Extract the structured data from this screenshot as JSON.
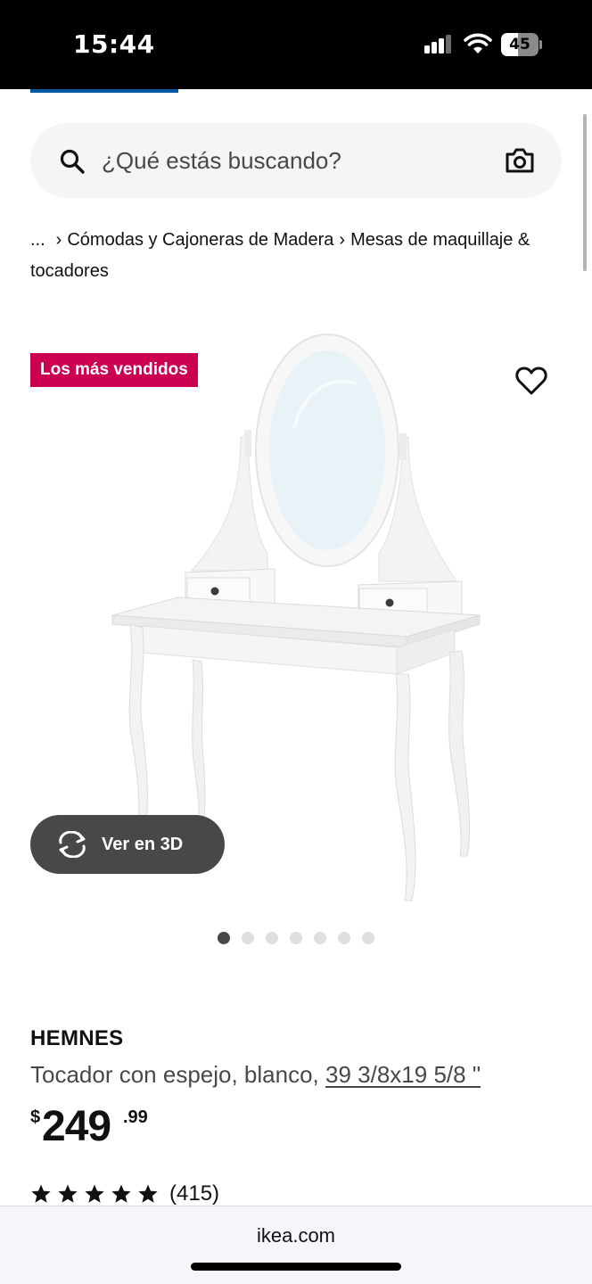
{
  "status_bar": {
    "time": "15:44",
    "battery": {
      "label": "45",
      "level": 0.45
    },
    "signal_icon": "cellular-signal-icon",
    "wifi_icon": "wifi-icon"
  },
  "search": {
    "placeholder": "¿Qué estás buscando?",
    "search_icon": "search-icon",
    "camera_icon": "camera-icon"
  },
  "breadcrumb": {
    "ellipsis": "...",
    "items": [
      "Cómodas y Cajoneras de Madera",
      "Mesas de maquillaje & tocadores"
    ]
  },
  "product": {
    "badge": "Los más vendidos",
    "view_3d_label": "Ver en 3D",
    "gallery": {
      "total": 7,
      "active_index": 0
    },
    "name": "HEMNES",
    "description": "Tocador con espejo, blanco,",
    "size": "39 3/8x19 5/8 \"",
    "price": {
      "currency": "$",
      "integer": "249",
      "decimal": ".99"
    },
    "rating": {
      "stars": 5,
      "count": "(415)"
    }
  },
  "browser": {
    "url": "ikea.com"
  },
  "colors": {
    "badge": "#cc0050",
    "accent": "#0058a3",
    "view3d_button": "#484848",
    "text": "#111111"
  }
}
